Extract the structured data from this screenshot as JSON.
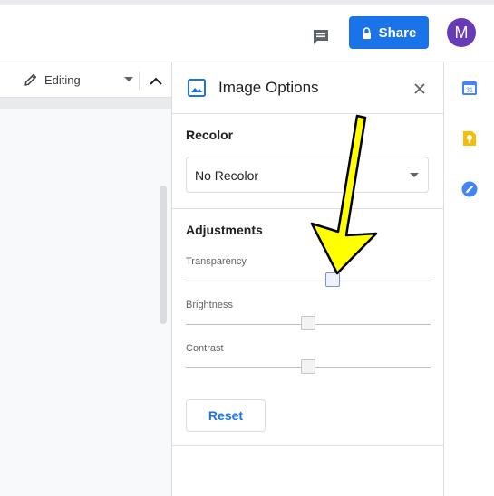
{
  "header": {
    "share_label": "Share",
    "avatar_initial": "M",
    "icons": {
      "comment": "comment-icon",
      "lock": "lock-icon"
    },
    "colors": {
      "share": "#1a73e8",
      "avatar": "#673ab7"
    }
  },
  "toolbar": {
    "editing_label": "Editing",
    "icons": {
      "edit": "pencil-icon",
      "dropdown": "chevron-down-icon",
      "collapse": "chevron-up-icon"
    }
  },
  "image_options": {
    "title": "Image Options",
    "icons": {
      "panel": "image-icon",
      "close": "close-icon"
    },
    "recolor": {
      "heading": "Recolor",
      "selected": "No Recolor"
    },
    "adjustments": {
      "heading": "Adjustments",
      "sliders": [
        {
          "label": "Transparency",
          "value_fraction": 0.6
        },
        {
          "label": "Brightness",
          "value_fraction": 0.5
        },
        {
          "label": "Contrast",
          "value_fraction": 0.5
        }
      ],
      "reset_label": "Reset"
    }
  },
  "side_rail": {
    "calendar_day": "31",
    "icons": [
      "calendar-icon",
      "keep-icon",
      "tasks-icon"
    ],
    "colors": {
      "calendar": "#4285f4",
      "keep": "#fbbc04",
      "tasks": "#4285f4"
    }
  },
  "annotation": {
    "arrow_color": "#ffff00",
    "arrow_outline": "#000000"
  }
}
